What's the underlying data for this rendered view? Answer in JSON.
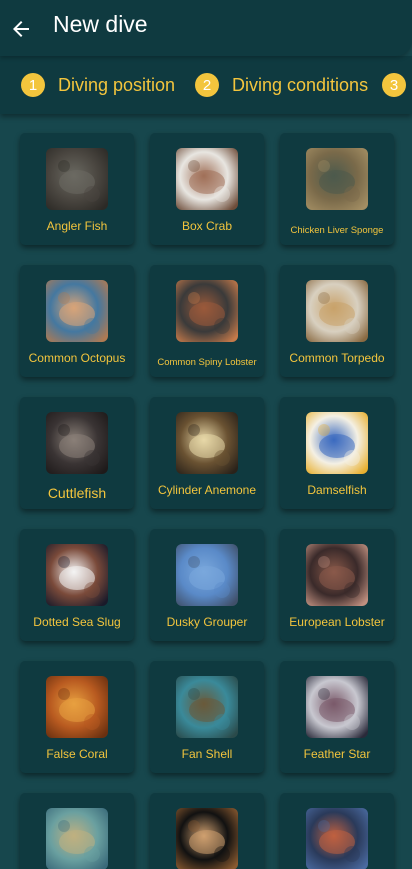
{
  "header": {
    "title": "New dive",
    "back_icon": "arrow-left-icon"
  },
  "steps": [
    {
      "number": "1",
      "label": "Diving position"
    },
    {
      "number": "2",
      "label": "Diving conditions"
    },
    {
      "number": "3",
      "label": ""
    }
  ],
  "species": [
    {
      "name": "Angler Fish",
      "thumb_colors": [
        "#4a4640",
        "#6b6a62",
        "#2c2a26"
      ]
    },
    {
      "name": "Box Crab",
      "thumb_colors": [
        "#e8e6e1",
        "#a07058",
        "#6e4d3a"
      ]
    },
    {
      "name": "Chicken Liver Sponge",
      "thumb_colors": [
        "#7a6a4a",
        "#4c5a4c",
        "#a38e63"
      ]
    },
    {
      "name": "Common Octopus",
      "thumb_colors": [
        "#4478a0",
        "#d8a478",
        "#b07a52"
      ]
    },
    {
      "name": "Common Spiny Lobster",
      "thumb_colors": [
        "#3a3a3a",
        "#9a5a3a",
        "#c67a4a"
      ]
    },
    {
      "name": "Common Torpedo",
      "thumb_colors": [
        "#d8d0c0",
        "#c9a26a",
        "#8a6a42"
      ]
    },
    {
      "name": "Cuttlefish",
      "thumb_colors": [
        "#3a3434",
        "#8a8078",
        "#1e1a1a"
      ]
    },
    {
      "name": "Cylinder Anemone",
      "thumb_colors": [
        "#6a5232",
        "#e8d8a8",
        "#2a221a"
      ]
    },
    {
      "name": "Damselfish",
      "thumb_colors": [
        "#f4f0e4",
        "#3a6ac0",
        "#e8b030"
      ]
    },
    {
      "name": "Dotted Sea Slug",
      "thumb_colors": [
        "#7a4a3a",
        "#f4f4f4",
        "#1a1a2a"
      ]
    },
    {
      "name": "Dusky Grouper",
      "thumb_colors": [
        "#5a8ac8",
        "#7aa8dc",
        "#40506a"
      ]
    },
    {
      "name": "European Lobster",
      "thumb_colors": [
        "#3a2a2a",
        "#8a5a4a",
        "#c09080"
      ]
    },
    {
      "name": "False Coral",
      "thumb_colors": [
        "#b85a20",
        "#e8a040",
        "#6a3010"
      ]
    },
    {
      "name": "Fan Shell",
      "thumb_colors": [
        "#3a8a9a",
        "#6a5a3a",
        "#2a4a4a"
      ]
    },
    {
      "name": "Feather Star",
      "thumb_colors": [
        "#c8c8d0",
        "#7a5a6a",
        "#2a2a3a"
      ]
    },
    {
      "name": "",
      "thumb_colors": [
        "#6aa0a0",
        "#c0b080",
        "#3a6a7a"
      ]
    },
    {
      "name": "",
      "thumb_colors": [
        "#111111",
        "#d0a070",
        "#8a5a30"
      ]
    },
    {
      "name": "",
      "thumb_colors": [
        "#2a3a5a",
        "#c06040",
        "#4a6aa0"
      ]
    }
  ],
  "colors": {
    "background": "#17474d",
    "surface": "#0f3a40",
    "accent": "#f3c53d",
    "text": "#ffffff"
  }
}
